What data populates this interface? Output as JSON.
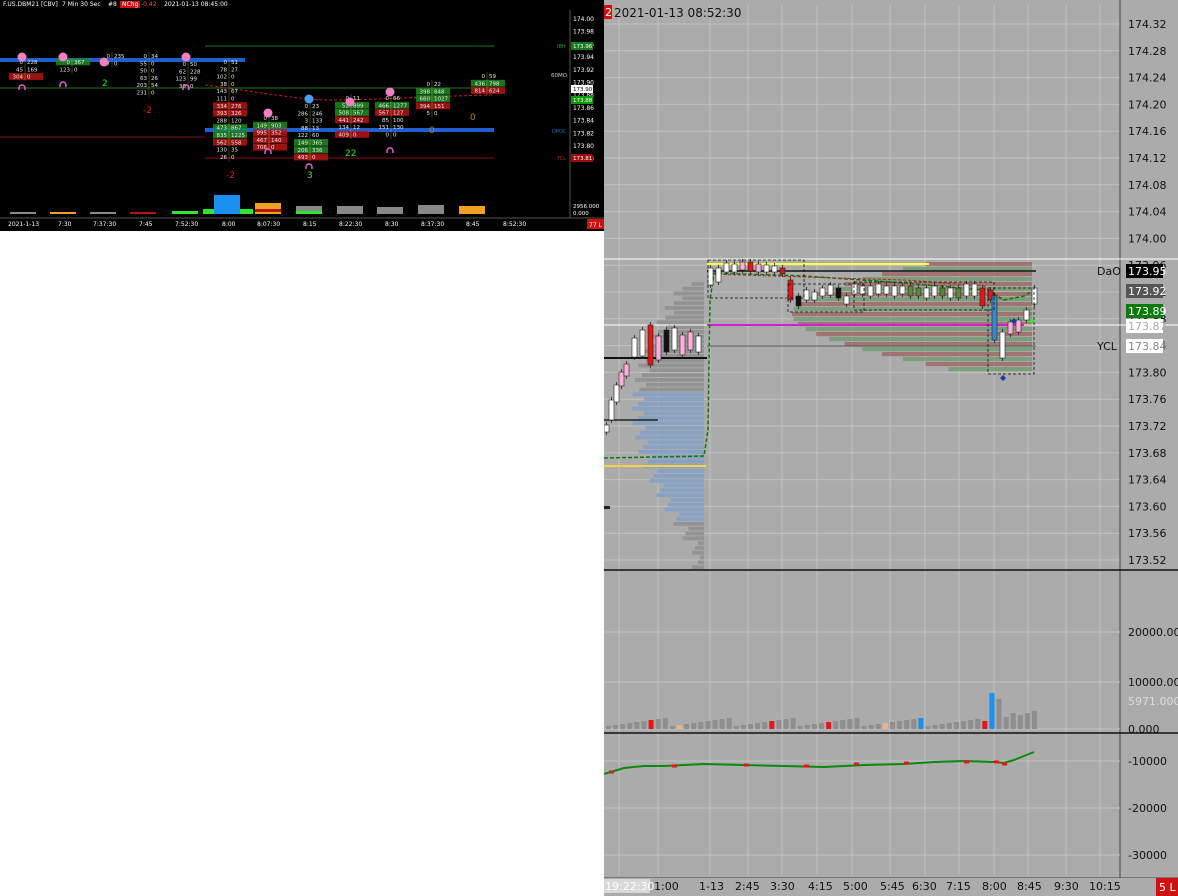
{
  "left": {
    "title": {
      "instrument": "F.US.DBM21 [CBV]",
      "interval": "7 Min 30 Sec",
      "id": "#8",
      "chg_label": "NChg",
      "chg_value": "-0.42",
      "datetime": "2021-01-13 08:45:00"
    },
    "price_ticks": [
      "174.00",
      "173.98",
      "173.96",
      "173.94",
      "173.92",
      "173.90",
      "173.88",
      "173.86",
      "173.84",
      "173.82",
      "173.80",
      "173.78"
    ],
    "level_labels": {
      "ibh": "IBH",
      "ibh_price": "173.96",
      "mo60": "60MO",
      "current_price": "173.90",
      "green_price": "173.88",
      "dpoc": "DPOC",
      "red_label": "YCL",
      "red_price": "173.81"
    },
    "volume_label": "2956.000",
    "volume_zero": "0.000",
    "time_ticks": [
      "2021-1-13",
      "7:30",
      "7:37:30",
      "7:45",
      "7:52:30",
      "8:00",
      "8:07:30",
      "8:15",
      "8:22:30",
      "8:30",
      "8:37:30",
      "8:45",
      "8:52:30"
    ],
    "corner_badge": "77 L",
    "delta_labels": [
      "2",
      "-2",
      "-2",
      "3",
      "22",
      "0",
      "0"
    ],
    "footprint_cols": [
      {
        "rows": [
          [
            "0",
            "228"
          ],
          [
            "45",
            "169"
          ],
          [
            "304",
            "0"
          ]
        ]
      },
      {
        "rows": [
          [
            "0",
            "367"
          ],
          [
            "123",
            "0"
          ]
        ]
      },
      {
        "rows": [
          [
            "0",
            "235"
          ],
          [
            "7",
            "0"
          ]
        ]
      },
      {
        "rows": [
          [
            "0",
            "34"
          ],
          [
            "55",
            "0"
          ],
          [
            "50",
            "0"
          ],
          [
            "63",
            "26"
          ],
          [
            "203",
            "54"
          ],
          [
            "231",
            "0"
          ]
        ]
      },
      {
        "rows": [
          [
            "0",
            "50"
          ],
          [
            "62",
            "228"
          ],
          [
            "123",
            "99"
          ],
          [
            "30",
            "0"
          ]
        ]
      },
      {
        "rows": [
          [
            "0",
            "51"
          ],
          [
            "78",
            "27"
          ],
          [
            "102",
            "0"
          ],
          [
            "38",
            "0"
          ],
          [
            "143",
            "67"
          ],
          [
            "111",
            "0"
          ],
          [
            "334",
            "276"
          ],
          [
            "393",
            "326"
          ],
          [
            "288",
            "120"
          ],
          [
            "473",
            "867"
          ],
          [
            "835",
            "1225"
          ],
          [
            "562",
            "558"
          ],
          [
            "130",
            "35"
          ],
          [
            "26",
            "0"
          ]
        ]
      },
      {
        "rows": [
          [
            "0",
            "38"
          ],
          [
            "149",
            "903"
          ],
          [
            "995",
            "352"
          ],
          [
            "467",
            "140"
          ],
          [
            "706",
            "0"
          ]
        ]
      },
      {
        "rows": [
          [
            "0",
            "23"
          ],
          [
            "286",
            "246"
          ],
          [
            "3",
            "133"
          ],
          [
            "88",
            "13"
          ],
          [
            "122",
            "60"
          ],
          [
            "149",
            "365"
          ],
          [
            "206",
            "336"
          ],
          [
            "493",
            "0"
          ]
        ]
      },
      {
        "rows": [
          [
            "0",
            "11"
          ],
          [
            "52",
            "899"
          ],
          [
            "508",
            "567"
          ],
          [
            "441",
            "242"
          ],
          [
            "134",
            "12"
          ],
          [
            "409",
            "0"
          ]
        ]
      },
      {
        "rows": [
          [
            "0",
            "66"
          ],
          [
            "466",
            "1277"
          ],
          [
            "567",
            "127"
          ],
          [
            "85",
            "100"
          ],
          [
            "151",
            "130"
          ],
          [
            "0",
            "0"
          ]
        ]
      },
      {
        "rows": [
          [
            "0",
            "22"
          ],
          [
            "398",
            "848"
          ],
          [
            "660",
            "1027"
          ],
          [
            "394",
            "151"
          ],
          [
            "5",
            "0"
          ]
        ]
      },
      {
        "rows": [
          [
            "0",
            "59"
          ],
          [
            "436",
            "798"
          ],
          [
            "814",
            "624"
          ]
        ]
      }
    ]
  },
  "right": {
    "header_marker": "2",
    "header_datetime": "2021-01-13 08:52:30",
    "price_ticks": [
      "174.32",
      "174.28",
      "174.24",
      "174.20",
      "174.16",
      "174.12",
      "174.08",
      "174.04",
      "174.00",
      "173.96",
      "173.92",
      "173.88",
      "173.84",
      "173.80",
      "173.76",
      "173.72",
      "173.68",
      "173.64",
      "173.60",
      "173.56",
      "173.52"
    ],
    "right_labels": [
      {
        "label": "DaO",
        "price": "173.95",
        "bg": "#000000",
        "fg": "#ffffff"
      },
      {
        "label": "",
        "price": "173.92",
        "bg": "#555555",
        "fg": "#ffffff"
      },
      {
        "label": "",
        "price": "173.89",
        "bg": "#0a7a0a",
        "fg": "#ffffff"
      },
      {
        "label": "",
        "price": "173.87",
        "bg": "#ffffff",
        "fg": "#aaaaaa"
      },
      {
        "label": "YCL",
        "price": "173.84",
        "bg": "#ffffff",
        "fg": "#888888"
      }
    ],
    "volume_ticks": [
      "20000.000",
      "10000.000",
      "5971.000",
      "0.000"
    ],
    "delta_ticks": [
      "-10000",
      "-20000",
      "-30000"
    ],
    "time_ticks": [
      "19:22:30",
      "1:00",
      "1-13",
      "2:45",
      "3:30",
      "4:15",
      "5:00",
      "5:45",
      "6:30",
      "7:15",
      "8:00",
      "8:45",
      "9:30",
      "10:15"
    ],
    "corner_badge": "5 L"
  },
  "colors": {
    "bg_black": "#000000",
    "bg_gray": "#ababab",
    "up": "#2ee62e",
    "down": "#e01818",
    "poc_blue": "#1f5fd0",
    "profile_blue": "#7f9fc7",
    "profile_green": "#6b9a6b",
    "profile_red": "#a06060",
    "magenta": "#d020d0",
    "yellow": "#ffff40"
  }
}
